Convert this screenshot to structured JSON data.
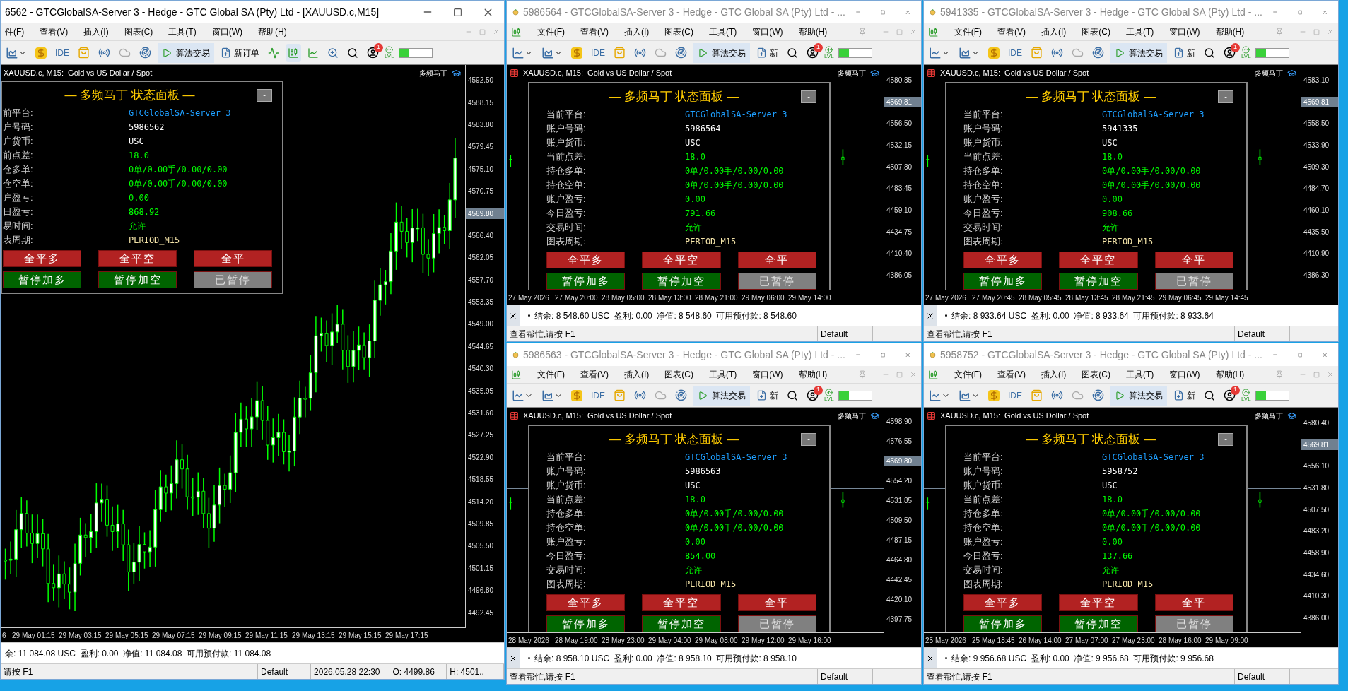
{
  "windows": [
    {
      "kind": "main",
      "active": true,
      "title": "6562 - GTCGlobalSA-Server 3 - Hedge - GTC Global SA (Pty) Ltd - [XAUUSD.c,M15]",
      "menu": [
        "件(F)",
        "查看(V)",
        "插入(I)",
        "图表(C)",
        "工具(T)",
        "窗口(W)",
        "帮助(H)"
      ],
      "toolbar": {
        "ide": "IDE",
        "algo": "算法交易",
        "order": "新订单",
        "badge": "1",
        "lvl": "LVL"
      },
      "chart": {
        "symbol": "XAUUSD.c, M15:  Gold vs US Dollar / Spot",
        "indicator": "多频马丁",
        "prices": [
          {
            "text": "4592.50",
            "kind": "tick"
          },
          {
            "text": "4588.15",
            "kind": "tick"
          },
          {
            "text": "4583.80",
            "kind": "tick"
          },
          {
            "text": "4579.45",
            "kind": "tick"
          },
          {
            "text": "4575.10",
            "kind": "tick"
          },
          {
            "text": "4570.75",
            "kind": "tick"
          },
          {
            "text": "4569.80",
            "kind": "current"
          },
          {
            "text": "4566.40",
            "kind": "tick"
          },
          {
            "text": "4562.05",
            "kind": "tick"
          },
          {
            "text": "4557.70",
            "kind": "tick"
          },
          {
            "text": "4553.35",
            "kind": "tick"
          },
          {
            "text": "4549.00",
            "kind": "tick"
          },
          {
            "text": "4544.65",
            "kind": "tick"
          },
          {
            "text": "4540.30",
            "kind": "tick"
          },
          {
            "text": "4535.95",
            "kind": "tick"
          },
          {
            "text": "4531.60",
            "kind": "tick"
          },
          {
            "text": "4527.25",
            "kind": "tick"
          },
          {
            "text": "4522.90",
            "kind": "tick"
          },
          {
            "text": "4518.55",
            "kind": "tick"
          },
          {
            "text": "4514.20",
            "kind": "tick"
          },
          {
            "text": "4509.85",
            "kind": "tick"
          },
          {
            "text": "4505.50",
            "kind": "tick"
          },
          {
            "text": "4501.15",
            "kind": "tick"
          },
          {
            "text": "4496.80",
            "kind": "tick"
          },
          {
            "text": "4492.45",
            "kind": "tick"
          }
        ],
        "times": [
          "6",
          "29 May 01:15",
          "29 May 03:15",
          "29 May 05:15",
          "29 May 07:15",
          "29 May 09:15",
          "29 May 11:15",
          "29 May 13:15",
          "29 May 15:15",
          "29 May 17:15"
        ]
      },
      "panel": {
        "title": "— 多频马丁 状态面板 —",
        "minimize": "-",
        "rows": [
          {
            "label": "前平台:",
            "value": "GTCGlobalSA-Server 3",
            "kind": "server"
          },
          {
            "label": "户号码:",
            "value": "5986562",
            "kind": "plain"
          },
          {
            "label": "户货币:",
            "value": "USC",
            "kind": "plain"
          },
          {
            "label": "前点差:",
            "value": "18.0",
            "kind": "good"
          },
          {
            "label": "仓多单:",
            "value": "0单/0.00手/0.00/0.00",
            "kind": "good"
          },
          {
            "label": "仓空单:",
            "value": "0单/0.00手/0.00/0.00",
            "kind": "good"
          },
          {
            "label": "户盈亏:",
            "value": "0.00",
            "kind": "good"
          },
          {
            "label": "日盈亏:",
            "value": "868.92",
            "kind": "good"
          },
          {
            "label": "易时间:",
            "value": "允许",
            "kind": "good"
          },
          {
            "label": "表周期:",
            "value": "PERIOD_M15",
            "kind": "period"
          }
        ],
        "buttons": [
          {
            "label": "全平多",
            "kind": "close"
          },
          {
            "label": "全平空",
            "kind": "close"
          },
          {
            "label": "全平",
            "kind": "close"
          },
          {
            "label": "暂停加多",
            "kind": "pause"
          },
          {
            "label": "暂停加空",
            "kind": "pause"
          },
          {
            "label": "已暂停",
            "kind": "paused"
          }
        ]
      },
      "trade": "余: 11 084.08 USC  盈利: 0.00  净值: 11 084.08  可用预付款: 11 084.08",
      "status": [
        "请按 F1",
        "Default",
        "2026.05.28 22:30",
        "O: 4499.86",
        "H: 4501.."
      ]
    },
    {
      "kind": "small",
      "active": false,
      "title": "5986564 - GTCGlobalSA-Server 3 - Hedge - GTC Global SA (Pty) Ltd - ...",
      "menu": [
        "文件(F)",
        "查看(V)",
        "插入(I)",
        "图表(C)",
        "工具(T)",
        "窗口(W)",
        "帮助(H)"
      ],
      "toolbar": {
        "ide": "IDE",
        "algo": "算法交易",
        "order": "新",
        "badge": "1",
        "lvl": "LVL"
      },
      "chart": {
        "symbol": "XAUUSD.c, M15:  Gold vs US Dollar / Spot",
        "indicator": "多频马丁",
        "prices": [
          {
            "text": "4580.85",
            "kind": "tick"
          },
          {
            "text": "4569.81",
            "kind": "current"
          },
          {
            "text": "4556.50",
            "kind": "tick"
          },
          {
            "text": "4532.15",
            "kind": "tick"
          },
          {
            "text": "4507.80",
            "kind": "tick"
          },
          {
            "text": "4483.45",
            "kind": "tick"
          },
          {
            "text": "4459.10",
            "kind": "tick"
          },
          {
            "text": "4434.75",
            "kind": "tick"
          },
          {
            "text": "4410.40",
            "kind": "tick"
          },
          {
            "text": "4386.05",
            "kind": "tick"
          }
        ],
        "times": [
          "27 May 2026",
          "27 May 20:00",
          "28 May 05:00",
          "28 May 13:00",
          "28 May 21:00",
          "29 May 06:00",
          "29 May 14:00"
        ]
      },
      "panel": {
        "title": "— 多频马丁 状态面板 —",
        "minimize": "-",
        "rows": [
          {
            "label": "当前平台:",
            "value": "GTCGlobalSA-Server 3",
            "kind": "server"
          },
          {
            "label": "账户号码:",
            "value": "5986564",
            "kind": "plain"
          },
          {
            "label": "账户货币:",
            "value": "USC",
            "kind": "plain"
          },
          {
            "label": "当前点差:",
            "value": "18.0",
            "kind": "good"
          },
          {
            "label": "持仓多单:",
            "value": "0单/0.00手/0.00/0.00",
            "kind": "good"
          },
          {
            "label": "持仓空单:",
            "value": "0单/0.00手/0.00/0.00",
            "kind": "good"
          },
          {
            "label": "账户盈亏:",
            "value": "0.00",
            "kind": "good"
          },
          {
            "label": "今日盈亏:",
            "value": "791.66",
            "kind": "good"
          },
          {
            "label": "交易时间:",
            "value": "允许",
            "kind": "good"
          },
          {
            "label": "图表周期:",
            "value": "PERIOD_M15",
            "kind": "period"
          }
        ],
        "buttons": [
          {
            "label": "全平多",
            "kind": "close"
          },
          {
            "label": "全平空",
            "kind": "close"
          },
          {
            "label": "全平",
            "kind": "close"
          },
          {
            "label": "暂停加多",
            "kind": "pause"
          },
          {
            "label": "暂停加空",
            "kind": "pause"
          },
          {
            "label": "已暂停",
            "kind": "paused"
          }
        ]
      },
      "trade": "结余: 8 548.60 USC  盈利: 0.00  净值: 8 548.60  可用预付款: 8 548.60",
      "status": [
        "查看帮忙,请按 F1",
        "Default"
      ]
    },
    {
      "kind": "small",
      "active": false,
      "title": "5986563 - GTCGlobalSA-Server 3 - Hedge - GTC Global SA (Pty) Ltd - ...",
      "menu": [
        "文件(F)",
        "查看(V)",
        "插入(I)",
        "图表(C)",
        "工具(T)",
        "窗口(W)",
        "帮助(H)"
      ],
      "toolbar": {
        "ide": "IDE",
        "algo": "算法交易",
        "order": "新",
        "badge": "1",
        "lvl": "LVL"
      },
      "chart": {
        "symbol": "XAUUSD.c, M15:  Gold vs US Dollar / Spot",
        "indicator": "多频马丁",
        "prices": [
          {
            "text": "4598.90",
            "kind": "tick"
          },
          {
            "text": "4576.55",
            "kind": "tick"
          },
          {
            "text": "4569.80",
            "kind": "current"
          },
          {
            "text": "4554.20",
            "kind": "tick"
          },
          {
            "text": "4531.85",
            "kind": "tick"
          },
          {
            "text": "4509.50",
            "kind": "tick"
          },
          {
            "text": "4487.15",
            "kind": "tick"
          },
          {
            "text": "4464.80",
            "kind": "tick"
          },
          {
            "text": "4442.45",
            "kind": "tick"
          },
          {
            "text": "4420.10",
            "kind": "tick"
          },
          {
            "text": "4397.75",
            "kind": "tick"
          }
        ],
        "times": [
          "28 May 2026",
          "28 May 19:00",
          "28 May 23:00",
          "29 May 04:00",
          "29 May 08:00",
          "29 May 12:00",
          "29 May 16:00"
        ]
      },
      "panel": {
        "title": "— 多频马丁 状态面板 —",
        "minimize": "-",
        "rows": [
          {
            "label": "当前平台:",
            "value": "GTCGlobalSA-Server 3",
            "kind": "server"
          },
          {
            "label": "账户号码:",
            "value": "5986563",
            "kind": "plain"
          },
          {
            "label": "账户货币:",
            "value": "USC",
            "kind": "plain"
          },
          {
            "label": "当前点差:",
            "value": "18.0",
            "kind": "good"
          },
          {
            "label": "持仓多单:",
            "value": "0单/0.00手/0.00/0.00",
            "kind": "good"
          },
          {
            "label": "持仓空单:",
            "value": "0单/0.00手/0.00/0.00",
            "kind": "good"
          },
          {
            "label": "账户盈亏:",
            "value": "0.00",
            "kind": "good"
          },
          {
            "label": "今日盈亏:",
            "value": "854.00",
            "kind": "good"
          },
          {
            "label": "交易时间:",
            "value": "允许",
            "kind": "good"
          },
          {
            "label": "图表周期:",
            "value": "PERIOD_M15",
            "kind": "period"
          }
        ],
        "buttons": [
          {
            "label": "全平多",
            "kind": "close"
          },
          {
            "label": "全平空",
            "kind": "close"
          },
          {
            "label": "全平",
            "kind": "close"
          },
          {
            "label": "暂停加多",
            "kind": "pause"
          },
          {
            "label": "暂停加空",
            "kind": "pause"
          },
          {
            "label": "已暂停",
            "kind": "paused"
          }
        ]
      },
      "trade": "结余: 8 958.10 USC  盈利: 0.00  净值: 8 958.10  可用预付款: 8 958.10",
      "status": [
        "查看帮忙,请按 F1",
        "Default"
      ]
    },
    {
      "kind": "small",
      "active": false,
      "title": "5941335 - GTCGlobalSA-Server 3 - Hedge - GTC Global SA (Pty) Ltd - ...",
      "menu": [
        "文件(F)",
        "查看(V)",
        "插入(I)",
        "图表(C)",
        "工具(T)",
        "窗口(W)",
        "帮助(H)"
      ],
      "toolbar": {
        "ide": "IDE",
        "algo": "算法交易",
        "order": "新",
        "badge": "1",
        "lvl": "LVL"
      },
      "chart": {
        "symbol": "XAUUSD.c, M15:  Gold vs US Dollar / Spot",
        "indicator": "多频马丁",
        "prices": [
          {
            "text": "4583.10",
            "kind": "tick"
          },
          {
            "text": "4569.81",
            "kind": "current"
          },
          {
            "text": "4558.50",
            "kind": "tick"
          },
          {
            "text": "4533.90",
            "kind": "tick"
          },
          {
            "text": "4509.30",
            "kind": "tick"
          },
          {
            "text": "4484.70",
            "kind": "tick"
          },
          {
            "text": "4460.10",
            "kind": "tick"
          },
          {
            "text": "4435.50",
            "kind": "tick"
          },
          {
            "text": "4410.90",
            "kind": "tick"
          },
          {
            "text": "4386.30",
            "kind": "tick"
          }
        ],
        "times": [
          "27 May 2026",
          "27 May 20:45",
          "28 May 05:45",
          "28 May 13:45",
          "28 May 21:45",
          "29 May 06:45",
          "29 May 14:45"
        ]
      },
      "panel": {
        "title": "— 多频马丁 状态面板 —",
        "minimize": "-",
        "rows": [
          {
            "label": "当前平台:",
            "value": "GTCGlobalSA-Server 3",
            "kind": "server"
          },
          {
            "label": "账户号码:",
            "value": "5941335",
            "kind": "plain"
          },
          {
            "label": "账户货币:",
            "value": "USC",
            "kind": "plain"
          },
          {
            "label": "当前点差:",
            "value": "18.0",
            "kind": "good"
          },
          {
            "label": "持仓多单:",
            "value": "0单/0.00手/0.00/0.00",
            "kind": "good"
          },
          {
            "label": "持仓空单:",
            "value": "0单/0.00手/0.00/0.00",
            "kind": "good"
          },
          {
            "label": "账户盈亏:",
            "value": "0.00",
            "kind": "good"
          },
          {
            "label": "今日盈亏:",
            "value": "908.66",
            "kind": "good"
          },
          {
            "label": "交易时间:",
            "value": "允许",
            "kind": "good"
          },
          {
            "label": "图表周期:",
            "value": "PERIOD_M15",
            "kind": "period"
          }
        ],
        "buttons": [
          {
            "label": "全平多",
            "kind": "close"
          },
          {
            "label": "全平空",
            "kind": "close"
          },
          {
            "label": "全平",
            "kind": "close"
          },
          {
            "label": "暂停加多",
            "kind": "pause"
          },
          {
            "label": "暂停加空",
            "kind": "pause"
          },
          {
            "label": "已暂停",
            "kind": "paused"
          }
        ]
      },
      "trade": "结余: 8 933.64 USC  盈利: 0.00  净值: 8 933.64  可用预付款: 8 933.64",
      "status": [
        "查看帮忙,请按 F1",
        "Default"
      ]
    },
    {
      "kind": "small",
      "active": false,
      "title": "5958752 - GTCGlobalSA-Server 3 - Hedge - GTC Global SA (Pty) Ltd - ...",
      "menu": [
        "文件(F)",
        "查看(V)",
        "插入(I)",
        "图表(C)",
        "工具(T)",
        "窗口(W)",
        "帮助(H)"
      ],
      "toolbar": {
        "ide": "IDE",
        "algo": "算法交易",
        "order": "新",
        "badge": "1",
        "lvl": "LVL"
      },
      "chart": {
        "symbol": "XAUUSD.c, M15:  Gold vs US Dollar / Spot",
        "indicator": "多频马丁",
        "prices": [
          {
            "text": "4580.40",
            "kind": "tick"
          },
          {
            "text": "4569.81",
            "kind": "current"
          },
          {
            "text": "4556.10",
            "kind": "tick"
          },
          {
            "text": "4531.80",
            "kind": "tick"
          },
          {
            "text": "4507.50",
            "kind": "tick"
          },
          {
            "text": "4483.20",
            "kind": "tick"
          },
          {
            "text": "4458.90",
            "kind": "tick"
          },
          {
            "text": "4434.60",
            "kind": "tick"
          },
          {
            "text": "4410.30",
            "kind": "tick"
          },
          {
            "text": "4386.00",
            "kind": "tick"
          }
        ],
        "times": [
          "25 May 2026",
          "25 May 18:45",
          "26 May 14:00",
          "27 May 07:00",
          "27 May 23:00",
          "28 May 16:00",
          "29 May 09:00"
        ]
      },
      "panel": {
        "title": "— 多频马丁 状态面板 —",
        "minimize": "-",
        "rows": [
          {
            "label": "当前平台:",
            "value": "GTCGlobalSA-Server 3",
            "kind": "server"
          },
          {
            "label": "账户号码:",
            "value": "5958752",
            "kind": "plain"
          },
          {
            "label": "账户货币:",
            "value": "USC",
            "kind": "plain"
          },
          {
            "label": "当前点差:",
            "value": "18.0",
            "kind": "good"
          },
          {
            "label": "持仓多单:",
            "value": "0单/0.00手/0.00/0.00",
            "kind": "good"
          },
          {
            "label": "持仓空单:",
            "value": "0单/0.00手/0.00/0.00",
            "kind": "good"
          },
          {
            "label": "账户盈亏:",
            "value": "0.00",
            "kind": "good"
          },
          {
            "label": "今日盈亏:",
            "value": "137.66",
            "kind": "good"
          },
          {
            "label": "交易时间:",
            "value": "允许",
            "kind": "good"
          },
          {
            "label": "图表周期:",
            "value": "PERIOD_M15",
            "kind": "period"
          }
        ],
        "buttons": [
          {
            "label": "全平多",
            "kind": "close"
          },
          {
            "label": "全平空",
            "kind": "close"
          },
          {
            "label": "全平",
            "kind": "close"
          },
          {
            "label": "暂停加多",
            "kind": "pause"
          },
          {
            "label": "暂停加空",
            "kind": "pause"
          },
          {
            "label": "已暂停",
            "kind": "paused"
          }
        ]
      },
      "trade": "结余: 9 956.68 USC  盈利: 0.00  净值: 9 956.68  可用预付款: 9 956.68",
      "status": [
        "查看帮忙,请按 F1",
        "Default"
      ]
    }
  ]
}
